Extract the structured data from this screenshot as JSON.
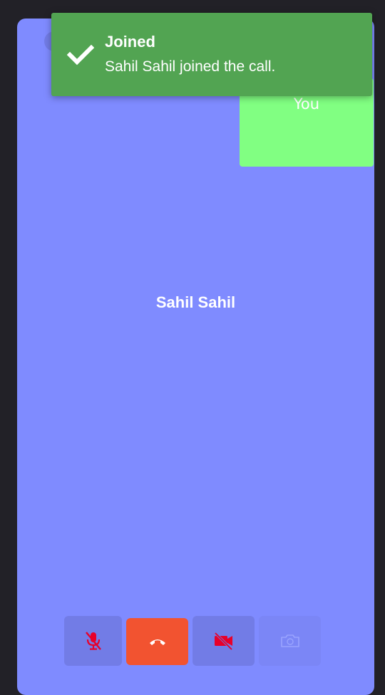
{
  "call": {
    "remote_participant": "Sahil Sahil",
    "self_label": "You"
  },
  "toast": {
    "title": "Joined",
    "message": "Sahil Sahil joined the call.",
    "icon": "check-icon"
  },
  "controls": {
    "mic": {
      "icon": "mic-off-icon",
      "state": "muted"
    },
    "end_call": {
      "icon": "phone-hangup-icon"
    },
    "camera": {
      "icon": "video-off-icon",
      "state": "off"
    },
    "flip_camera": {
      "icon": "camera-flip-icon",
      "state": "disabled"
    }
  },
  "colors": {
    "background": "#222127",
    "video_area": "#7f8bff",
    "self_tile": "#81ff82",
    "toast": "#52a452",
    "end_call": "#f25330",
    "control_bg": "#727ce6",
    "muted_icon": "#e8002a"
  }
}
